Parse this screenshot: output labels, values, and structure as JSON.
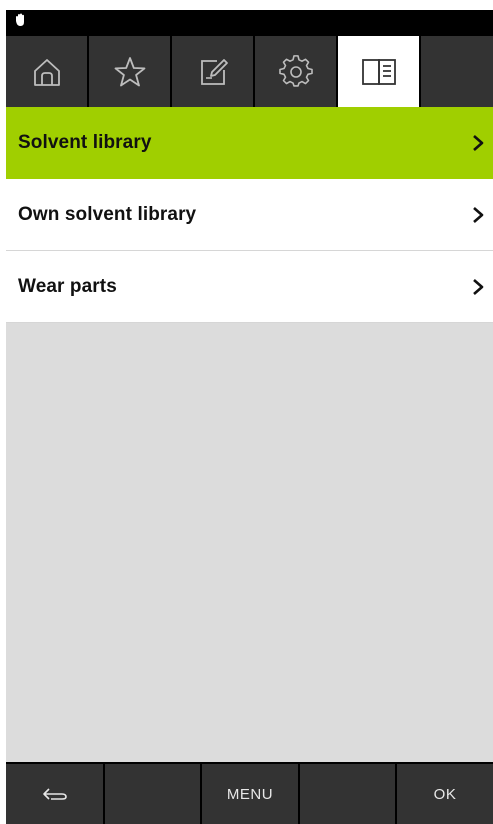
{
  "colors": {
    "accent": "#a0cf00",
    "tab_bg": "#333333",
    "bar_bg": "#000000",
    "content_bg": "#dcdcdc"
  },
  "status": {
    "icon": "hand-icon"
  },
  "tabs": [
    {
      "icon": "home-icon",
      "active": false
    },
    {
      "icon": "star-icon",
      "active": false
    },
    {
      "icon": "edit-icon",
      "active": false
    },
    {
      "icon": "gear-icon",
      "active": false
    },
    {
      "icon": "book-icon",
      "active": true
    }
  ],
  "menu": {
    "items": [
      {
        "label": "Solvent library",
        "selected": true
      },
      {
        "label": "Own solvent library",
        "selected": false
      },
      {
        "label": "Wear parts",
        "selected": false
      }
    ]
  },
  "bottom_bar": {
    "back_icon": "back-arrow-icon",
    "menu_label": "MENU",
    "ok_label": "OK"
  }
}
